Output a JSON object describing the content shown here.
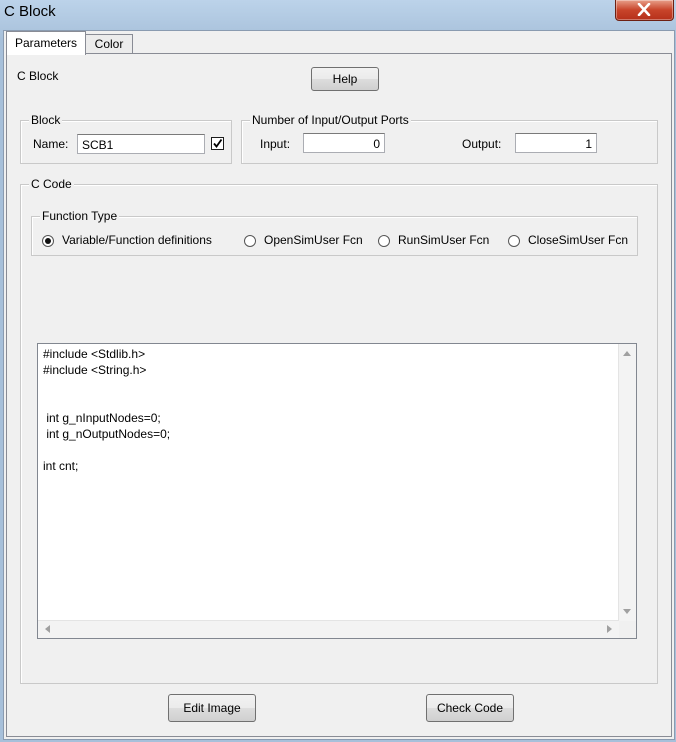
{
  "window": {
    "title": "C Block"
  },
  "tabs": [
    {
      "label": "Parameters"
    },
    {
      "label": "Color"
    }
  ],
  "header": {
    "label": "C Block",
    "help_label": "Help"
  },
  "block_group": {
    "title": "Block",
    "name_label": "Name:",
    "name_value": "SCB1",
    "checked": true
  },
  "ports_group": {
    "title": "Number of Input/Output Ports",
    "input_label": "Input:",
    "input_value": "0",
    "output_label": "Output:",
    "output_value": "1"
  },
  "code_group": {
    "title": "C Code"
  },
  "function_type": {
    "title": "Function Type",
    "options": [
      {
        "label": "Variable/Function definitions",
        "selected": true
      },
      {
        "label": "OpenSimUser Fcn",
        "selected": false
      },
      {
        "label": "RunSimUser Fcn",
        "selected": false
      },
      {
        "label": "CloseSimUser Fcn",
        "selected": false
      }
    ]
  },
  "code": {
    "lines": [
      "#include <Stdlib.h>",
      "#include <String.h>",
      "",
      "",
      " int g_nInputNodes=0;",
      " int g_nOutputNodes=0;",
      "",
      "int cnt;"
    ]
  },
  "buttons": {
    "edit_image": "Edit Image",
    "check_code": "Check Code"
  }
}
